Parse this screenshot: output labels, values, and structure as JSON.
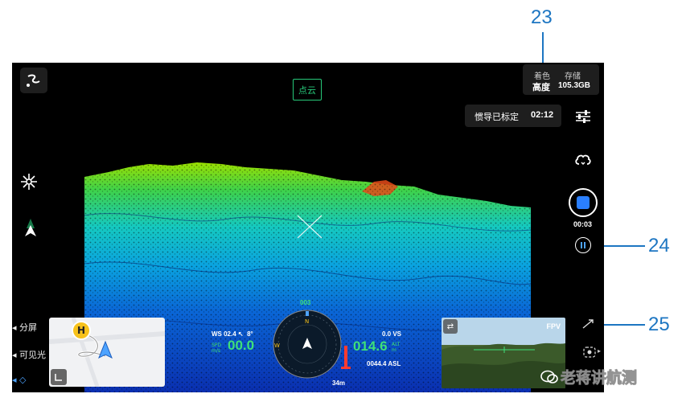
{
  "callouts": {
    "c23": "23",
    "c24": "24",
    "c25": "25"
  },
  "top": {
    "mode_label": "点云",
    "color_by_label": "着色",
    "color_by_value": "高度",
    "storage_label": "存储",
    "storage_value": "105.3GB",
    "imu_status": "惯导已标定",
    "imu_time": "02:12"
  },
  "record": {
    "timer": "00:03"
  },
  "left_menu": {
    "split_screen": "分屏",
    "visible_light": "可见光"
  },
  "minimap": {
    "home_label": "H"
  },
  "hud": {
    "ws_label": "WS 02.4",
    "wind_angle": "8°",
    "speed_top": "SPD",
    "speed_unit": "m/s",
    "speed_value": "00.0",
    "vs_label": "0.0 VS",
    "alt_value": "014.6",
    "alt_top": "ALT",
    "alt_unit": "m",
    "asl_value": "0044.4 ASL",
    "heading": "003",
    "distance": "34m",
    "compass_n": "N",
    "compass_w": "W"
  },
  "fpv": {
    "label": "FPV"
  },
  "watermark": "老蒋讲航测",
  "colors": {
    "accent": "#1d76c2",
    "mode_green": "#27c97a",
    "hud_green": "#3fe07a",
    "record_blue": "#2a7fff",
    "alt_red": "#ff3b30"
  }
}
